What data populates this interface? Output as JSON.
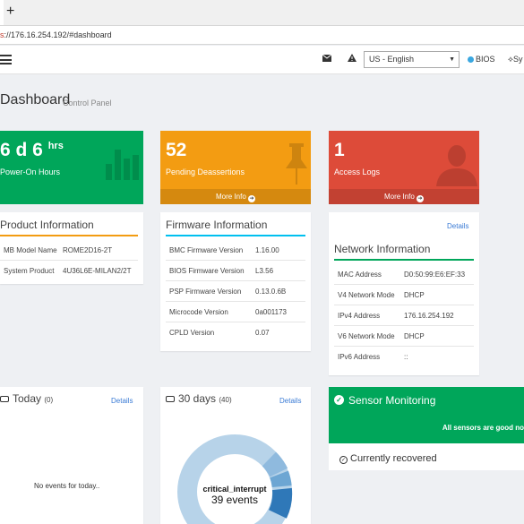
{
  "browser": {
    "new_tab_label": "+",
    "url_scheme": "s",
    "url_rest": "://176.16.254.192/#dashboard"
  },
  "topnav": {
    "mail_icon": "envelope-icon",
    "warning_icon": "warning-icon",
    "language": "US - English",
    "bios_label": "BIOS",
    "sys_label": "Sy"
  },
  "page": {
    "title": "Dashboard",
    "subtitle": "Control Panel"
  },
  "tiles": {
    "power_on": {
      "value": "6 d 6",
      "unit": "hrs",
      "label": "Power-On Hours",
      "color": "#00a65a"
    },
    "deassertions": {
      "value": "52",
      "label": "Pending Deassertions",
      "more": "More Info",
      "color": "#f39c12"
    },
    "access_logs": {
      "value": "1",
      "label": "Access Logs",
      "more": "More Info",
      "color": "#dd4b39"
    }
  },
  "product": {
    "title": "Product Information",
    "rows": [
      {
        "k": "MB Model Name",
        "v": "ROME2D16-2T"
      },
      {
        "k": "System Product",
        "v": "4U36L6E-MILAN2/2T"
      }
    ]
  },
  "firmware": {
    "title": "Firmware Information",
    "rows": [
      {
        "k": "BMC Firmware Version",
        "v": "1.16.00"
      },
      {
        "k": "BIOS Firmware Version",
        "v": "L3.56"
      },
      {
        "k": "PSP Firmware Version",
        "v": "0.13.0.6B"
      },
      {
        "k": "Microcode Version",
        "v": "0a001173"
      },
      {
        "k": "CPLD Version",
        "v": "0.07"
      }
    ]
  },
  "network": {
    "details": "Details",
    "title": "Network Information",
    "rows": [
      {
        "k": "MAC Address",
        "v": "D0:50:99:E6:EF:33"
      },
      {
        "k": "V4 Network Mode",
        "v": "DHCP"
      },
      {
        "k": "IPv4 Address",
        "v": "176.16.254.192"
      },
      {
        "k": "V6 Network Mode",
        "v": "DHCP"
      },
      {
        "k": "IPv6 Address",
        "v": "::"
      }
    ]
  },
  "today": {
    "title": "Today",
    "count": "(0)",
    "details": "Details",
    "empty": "No events for today.."
  },
  "days30": {
    "title": "30 days",
    "count": "(40)",
    "details": "Details",
    "donut_label": "critical_interrupt",
    "donut_value": "39 events"
  },
  "sensor": {
    "title": "Sensor Monitoring",
    "message": "All sensors are good no",
    "recovered": "Currently recovered"
  }
}
